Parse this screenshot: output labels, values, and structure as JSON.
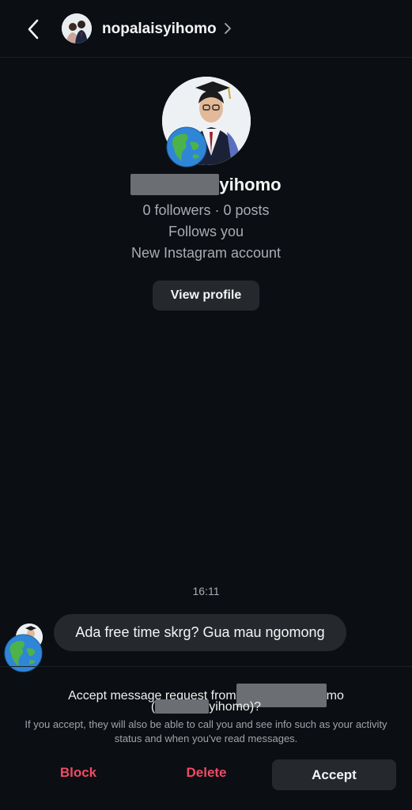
{
  "header": {
    "username": "nopalaisyihomo"
  },
  "profile": {
    "name_visible_part": "yihomo",
    "stats": "0 followers · 0 posts",
    "follows_status": "Follows you",
    "account_note": "New Instagram account",
    "view_profile_label": "View profile"
  },
  "conversation": {
    "timestamp": "16:11",
    "message": "Ada free time skrg? Gua mau ngomong"
  },
  "request": {
    "prompt_prefix": "Accept message request from",
    "prompt_name_suffix": "mo",
    "prompt_handle_open": "(",
    "prompt_handle_suffix": "yihomo)?",
    "description": "If you accept, they will also be able to call you and see info such as your activity status and when you've read messages.",
    "block_label": "Block",
    "delete_label": "Delete",
    "accept_label": "Accept"
  },
  "icons": {
    "back": "chevron-left-icon",
    "header_chevron": "chevron-right-icon",
    "globe": "globe-emoji-icon"
  },
  "colors": {
    "background": "#0b0e12",
    "surface": "#25282d",
    "danger": "#f04a66",
    "secondary_text": "#a9adb3"
  }
}
